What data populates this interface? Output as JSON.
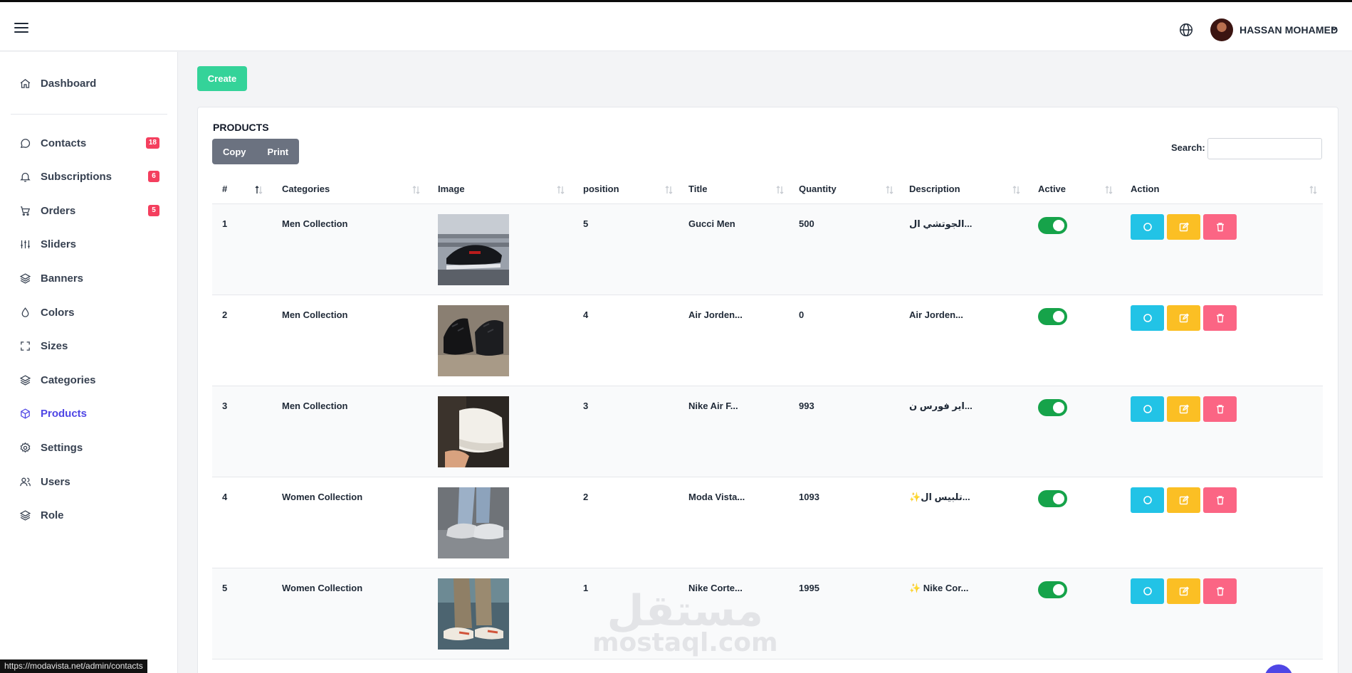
{
  "header": {
    "user_name": "HASSAN MOHAMED",
    "icons": [
      "menu-icon",
      "globe-icon",
      "chevron-down-icon"
    ]
  },
  "sidebar": {
    "items": [
      {
        "label": "Dashboard",
        "icon": "home-icon",
        "badge": "",
        "active": false
      },
      {
        "label": "Contacts",
        "icon": "chat-icon",
        "badge": "18",
        "active": false
      },
      {
        "label": "Subscriptions",
        "icon": "bell-icon",
        "badge": "6",
        "active": false
      },
      {
        "label": "Orders",
        "icon": "cart-icon",
        "badge": "5",
        "active": false
      },
      {
        "label": "Sliders",
        "icon": "sliders-icon",
        "badge": "",
        "active": false
      },
      {
        "label": "Banners",
        "icon": "layers-icon",
        "badge": "",
        "active": false
      },
      {
        "label": "Colors",
        "icon": "droplet-icon",
        "badge": "",
        "active": false
      },
      {
        "label": "Sizes",
        "icon": "resize-icon",
        "badge": "",
        "active": false
      },
      {
        "label": "Categories",
        "icon": "layers-icon",
        "badge": "",
        "active": false
      },
      {
        "label": "Products",
        "icon": "box-icon",
        "badge": "",
        "active": true
      },
      {
        "label": "Settings",
        "icon": "gear-icon",
        "badge": "",
        "active": false
      },
      {
        "label": "Users",
        "icon": "users-icon",
        "badge": "",
        "active": false
      },
      {
        "label": "Role",
        "icon": "layers-icon",
        "badge": "",
        "active": false
      }
    ],
    "active_color": "#4f46e5",
    "badge_color": "#f43f5e"
  },
  "toolbar": {
    "create_label": "Create",
    "create_color": "#34d399"
  },
  "products": {
    "title": "PRODUCTS",
    "copy_label": "Copy",
    "print_label": "Print",
    "search_label": "Search:",
    "search_value": "",
    "columns": [
      "#",
      "Categories",
      "Image",
      "position",
      "Title",
      "Quantity",
      "Description",
      "Active",
      "Action"
    ],
    "rows": [
      {
        "id": "1",
        "category": "Men Collection",
        "image": "shoe-photo",
        "position": "5",
        "title": "Gucci Men",
        "quantity": "500",
        "description": "الجوتشي ال...",
        "active": true
      },
      {
        "id": "2",
        "category": "Men Collection",
        "image": "shoe-photo",
        "position": "4",
        "title": "Air Jorden...",
        "quantity": "0",
        "description": "Air Jorden...",
        "active": true
      },
      {
        "id": "3",
        "category": "Men Collection",
        "image": "shoe-photo",
        "position": "3",
        "title": "Nike Air F...",
        "quantity": "993",
        "description": "اير فورس ن...",
        "active": true
      },
      {
        "id": "4",
        "category": "Women Collection",
        "image": "shoe-photo",
        "position": "2",
        "title": "Moda Vista...",
        "quantity": "1093",
        "description": "✨تلبيس ال...",
        "active": true
      },
      {
        "id": "5",
        "category": "Women Collection",
        "image": "shoe-photo",
        "position": "1",
        "title": "Nike Corte...",
        "quantity": "1995",
        "description": "✨ Nike Cor...",
        "active": true
      }
    ],
    "action_colors": {
      "view": "#22c3e6",
      "edit": "#fbbf24",
      "delete": "#fb6584"
    },
    "toggle_color": "#16a34a"
  },
  "watermark": {
    "logo": "مستقل",
    "url": "mostaql.com"
  },
  "statusbar": {
    "url": "https://modavista.net/admin/contacts"
  }
}
